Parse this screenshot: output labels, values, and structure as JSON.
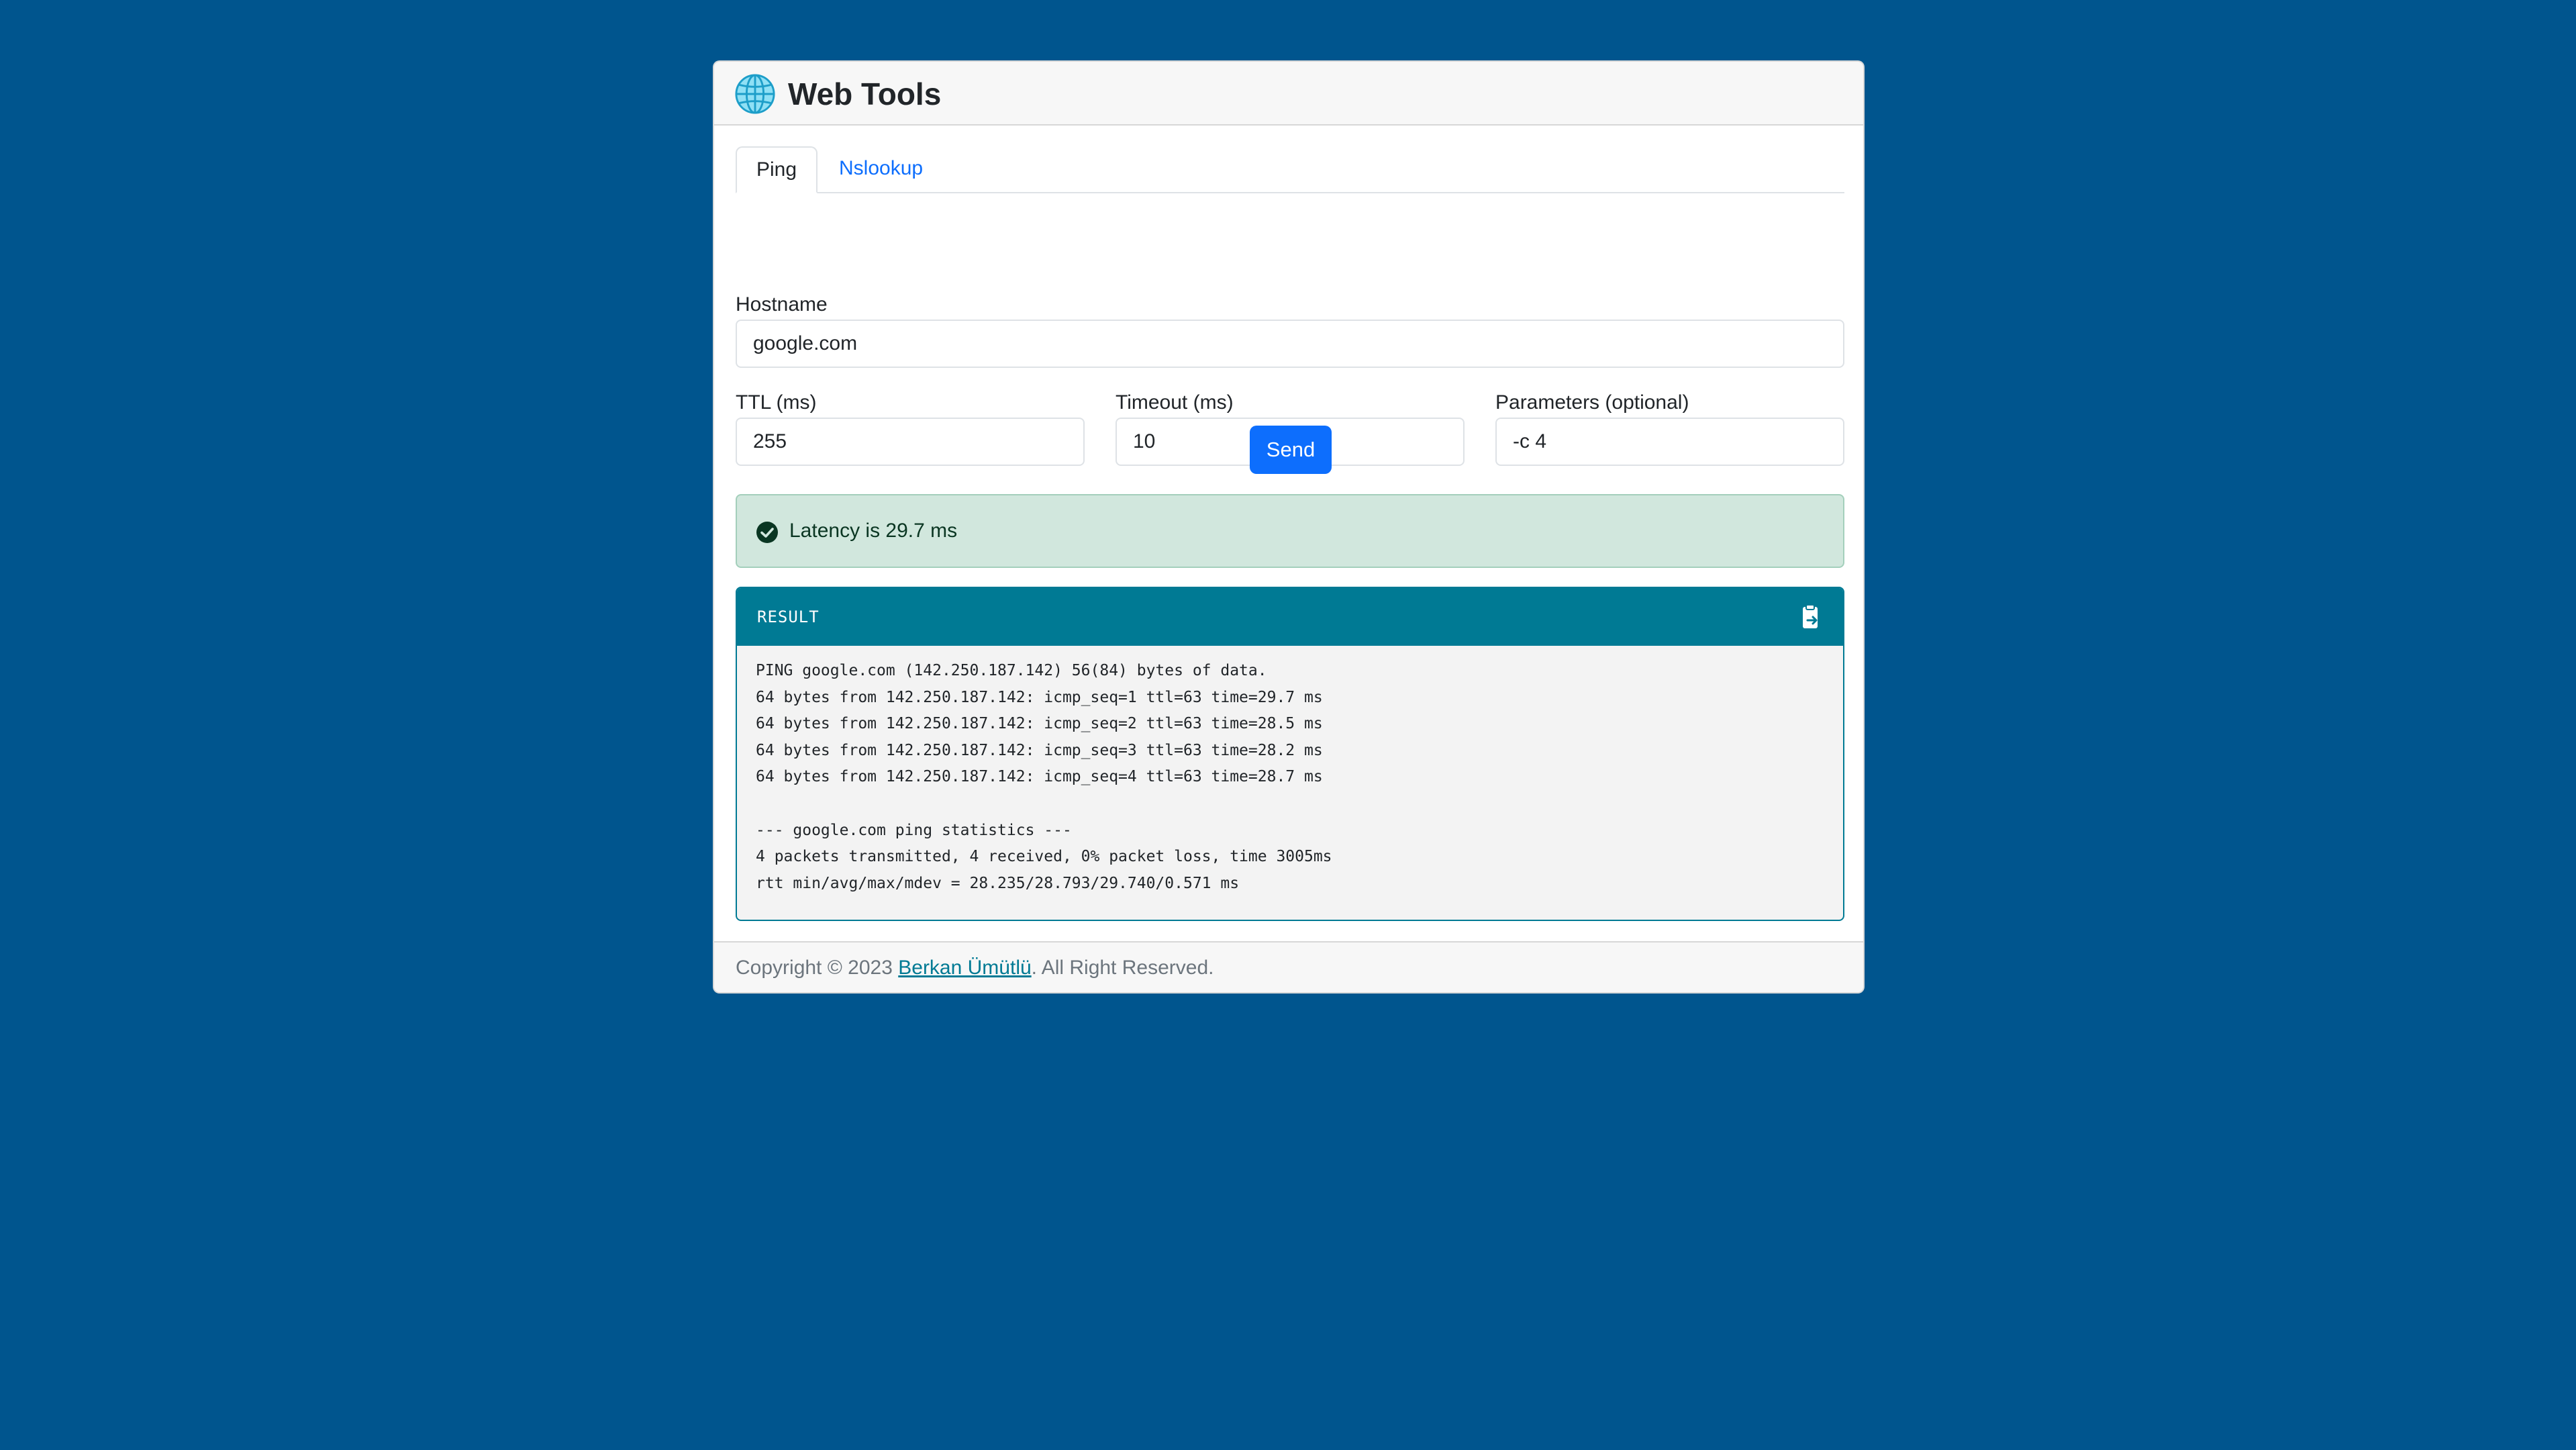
{
  "app": {
    "title": "Web Tools",
    "logo_icon": "globe-icon"
  },
  "tabs": [
    {
      "label": "Ping",
      "active": true
    },
    {
      "label": "Nslookup",
      "active": false
    }
  ],
  "form": {
    "hostname": {
      "label": "Hostname",
      "value": "google.com"
    },
    "ttl": {
      "label": "TTL (ms)",
      "value": "255"
    },
    "timeout": {
      "label": "Timeout (ms)",
      "value": "10"
    },
    "parameters": {
      "label": "Parameters (optional)",
      "value": "-c 4"
    },
    "send_label": "Send"
  },
  "alert": {
    "icon": "check-circle-icon",
    "text": "Latency is 29.7 ms"
  },
  "result": {
    "title": "RESULT",
    "copy_icon": "clipboard-icon",
    "lines": [
      "PING google.com (142.250.187.142) 56(84) bytes of data.",
      "64 bytes from 142.250.187.142: icmp_seq=1 ttl=63 time=29.7 ms",
      "64 bytes from 142.250.187.142: icmp_seq=2 ttl=63 time=28.5 ms",
      "64 bytes from 142.250.187.142: icmp_seq=3 ttl=63 time=28.2 ms",
      "64 bytes from 142.250.187.142: icmp_seq=4 ttl=63 time=28.7 ms",
      "",
      "--- google.com ping statistics ---",
      "4 packets transmitted, 4 received, 0% packet loss, time 3005ms",
      "rtt min/avg/max/mdev = 28.235/28.793/29.740/0.571 ms"
    ]
  },
  "footer": {
    "prefix": "Copyright © 2023 ",
    "author": "Berkan Ümütlü",
    "suffix": ". All Right Reserved."
  },
  "colors": {
    "background": "#00558e",
    "primary": "#0d6efd",
    "result_header": "#007a94",
    "success_bg": "#d1e7dd"
  }
}
